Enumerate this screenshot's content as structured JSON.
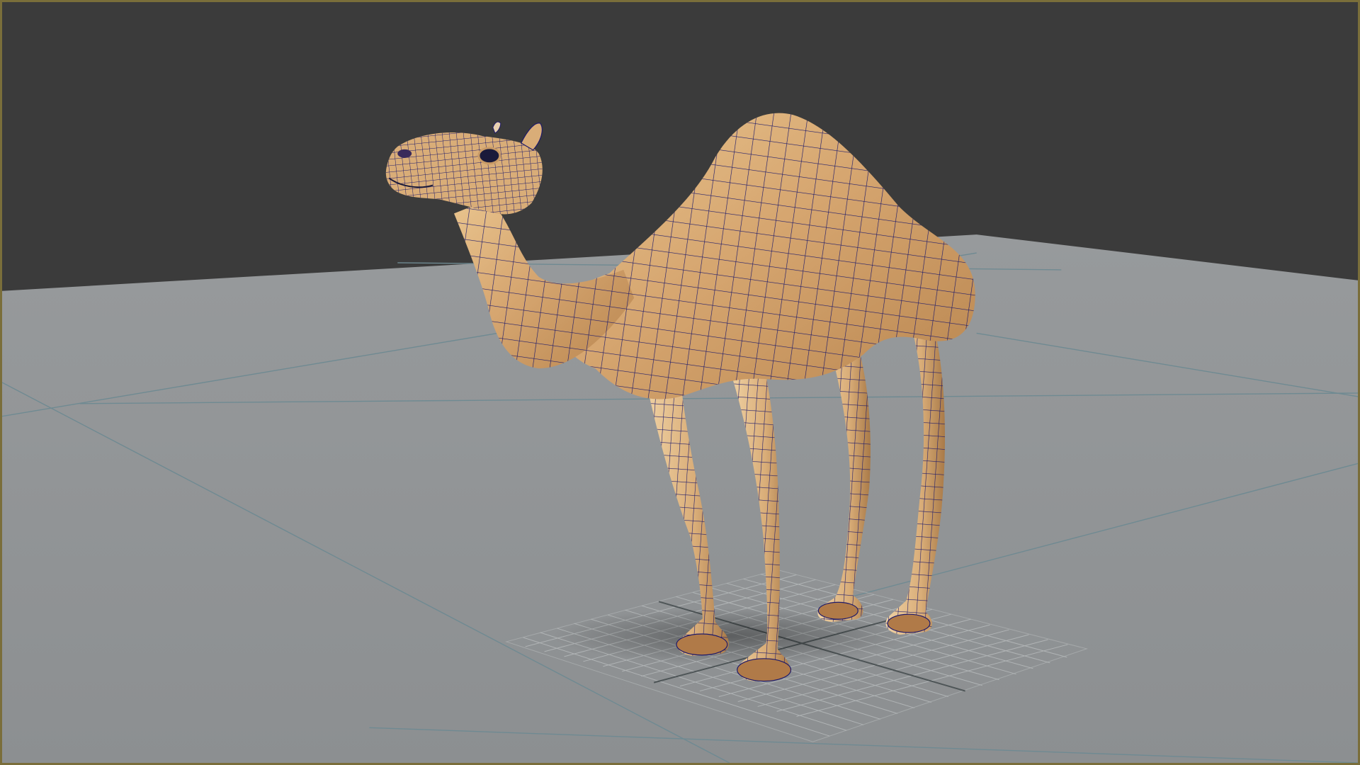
{
  "viewport": {
    "background_color": "#3b3b3b",
    "floor_color": "#8f9294",
    "frame_color": "#7a6e3a",
    "grid_line_color": "#6f8a92",
    "wireframe_color": "#1a1a66",
    "model_base_color": "#d9ae78",
    "display_mode": "shaded-wireframe"
  },
  "scene": {
    "model": "camel",
    "ground_grid": true
  }
}
